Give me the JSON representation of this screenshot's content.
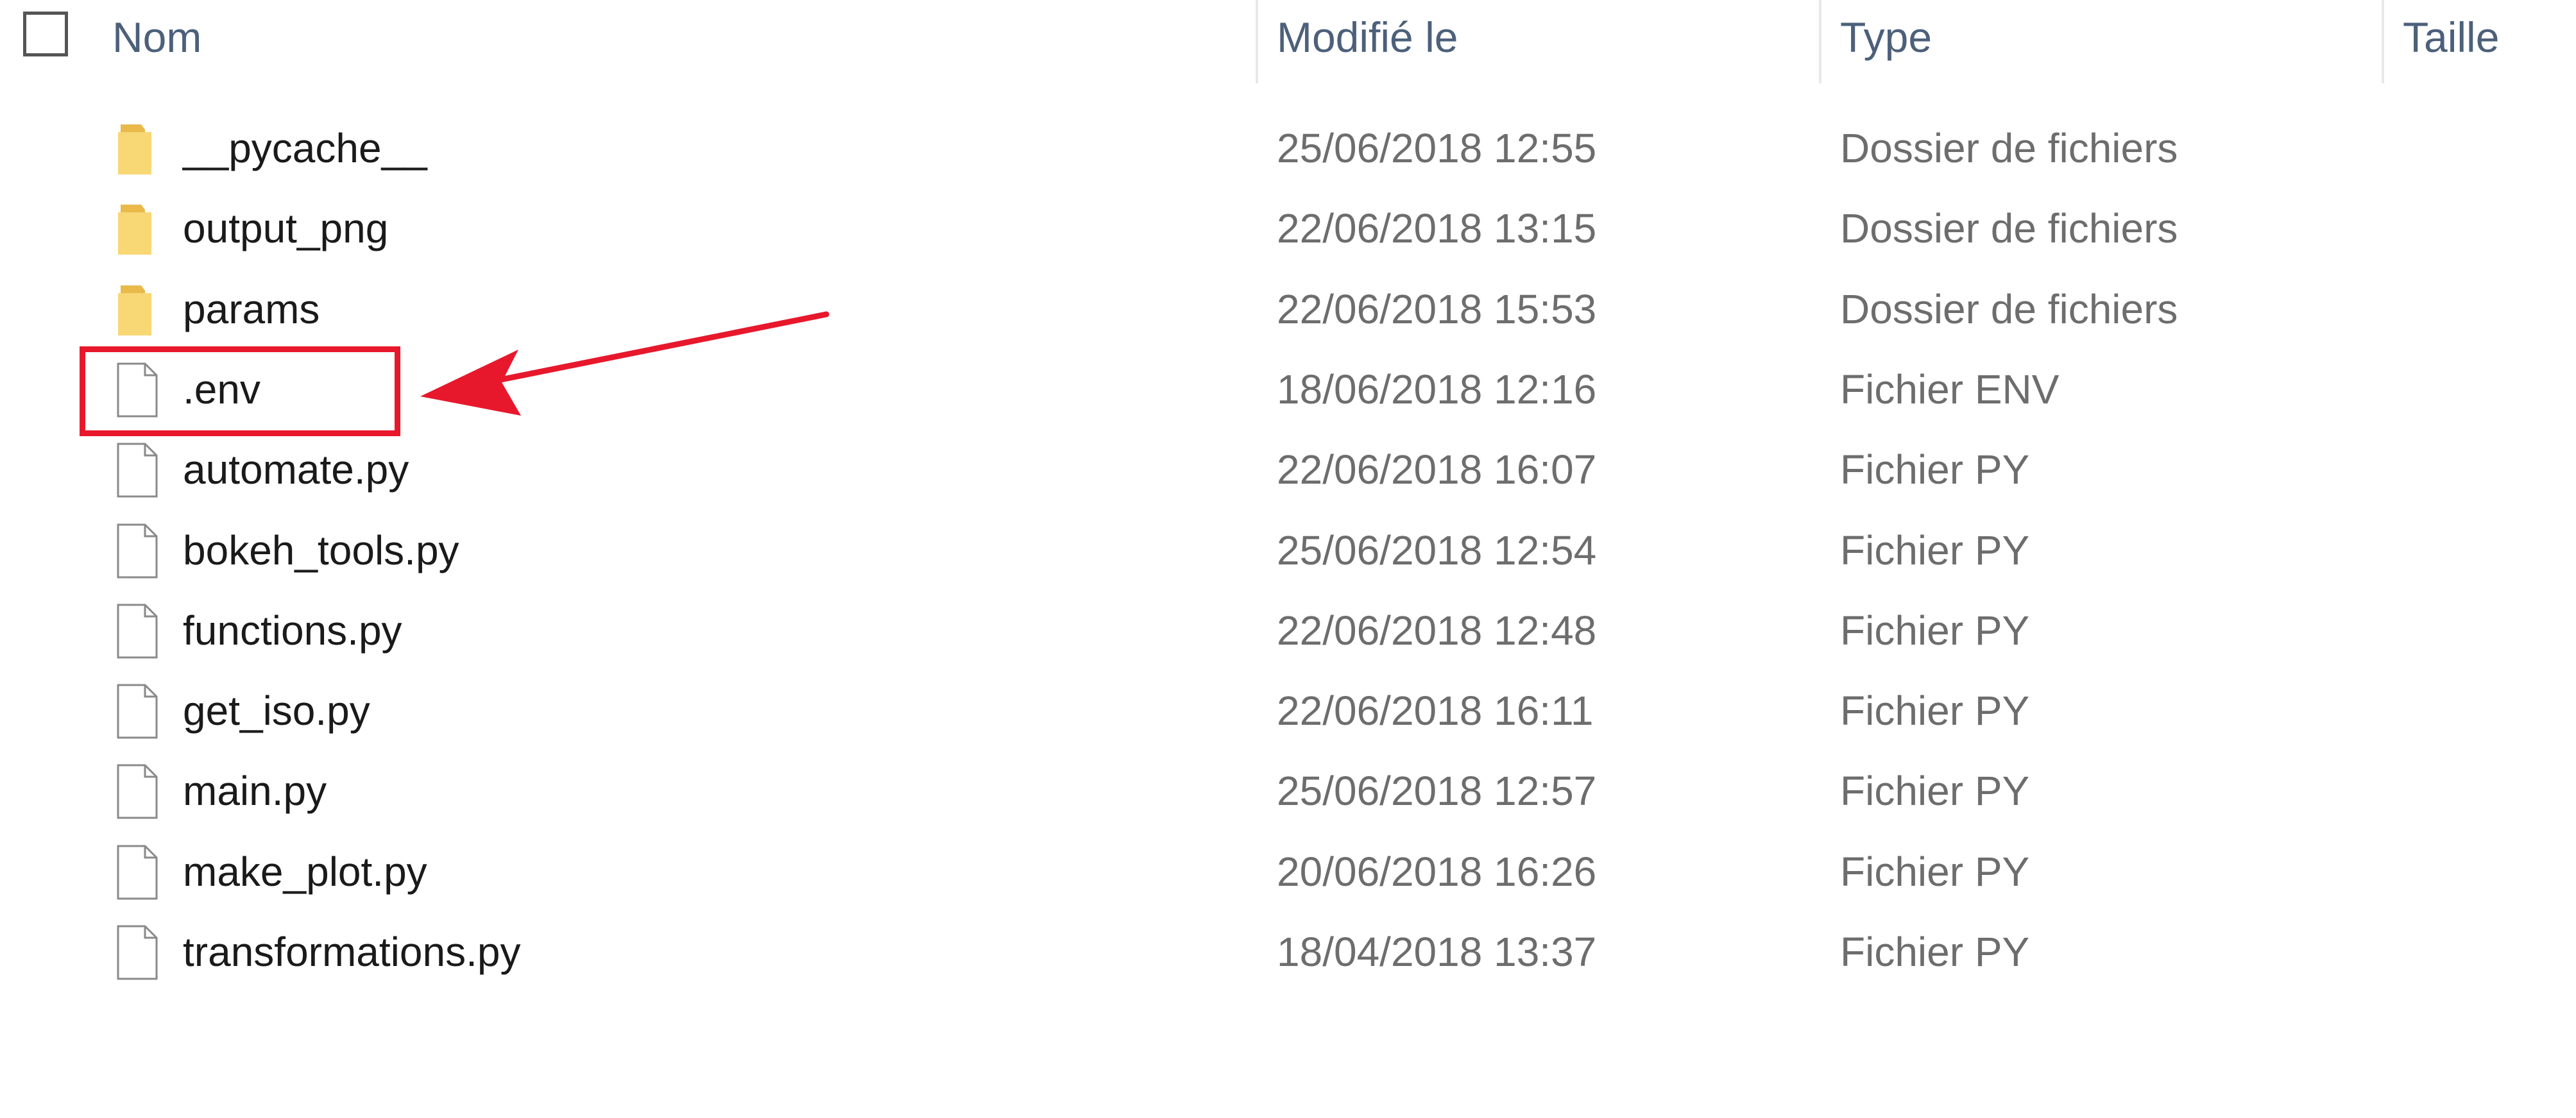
{
  "header": {
    "name_label": "Nom",
    "modified_label": "Modifié le",
    "type_label": "Type",
    "size_label": "Taille"
  },
  "files": [
    {
      "name": "__pycache__",
      "modified": "25/06/2018 12:55",
      "type": "Dossier de fichiers",
      "kind": "folder-icon"
    },
    {
      "name": "output_png",
      "modified": "22/06/2018 13:15",
      "type": "Dossier de fichiers",
      "kind": "folder-icon"
    },
    {
      "name": "params",
      "modified": "22/06/2018 15:53",
      "type": "Dossier de fichiers",
      "kind": "folder-icon"
    },
    {
      "name": ".env",
      "modified": "18/06/2018 12:16",
      "type": "Fichier ENV",
      "kind": "file-icon"
    },
    {
      "name": "automate.py",
      "modified": "22/06/2018 16:07",
      "type": "Fichier PY",
      "kind": "file-icon"
    },
    {
      "name": "bokeh_tools.py",
      "modified": "25/06/2018 12:54",
      "type": "Fichier PY",
      "kind": "file-icon"
    },
    {
      "name": "functions.py",
      "modified": "22/06/2018 12:48",
      "type": "Fichier PY",
      "kind": "file-icon"
    },
    {
      "name": "get_iso.py",
      "modified": "22/06/2018 16:11",
      "type": "Fichier PY",
      "kind": "file-icon"
    },
    {
      "name": "main.py",
      "modified": "25/06/2018 12:57",
      "type": "Fichier PY",
      "kind": "file-icon"
    },
    {
      "name": "make_plot.py",
      "modified": "20/06/2018 16:26",
      "type": "Fichier PY",
      "kind": "file-icon"
    },
    {
      "name": "transformations.py",
      "modified": "18/04/2018 13:37",
      "type": "Fichier PY",
      "kind": "file-icon"
    }
  ],
  "annotation": {
    "highlighted_file": ".env",
    "color": "#e8182c"
  }
}
